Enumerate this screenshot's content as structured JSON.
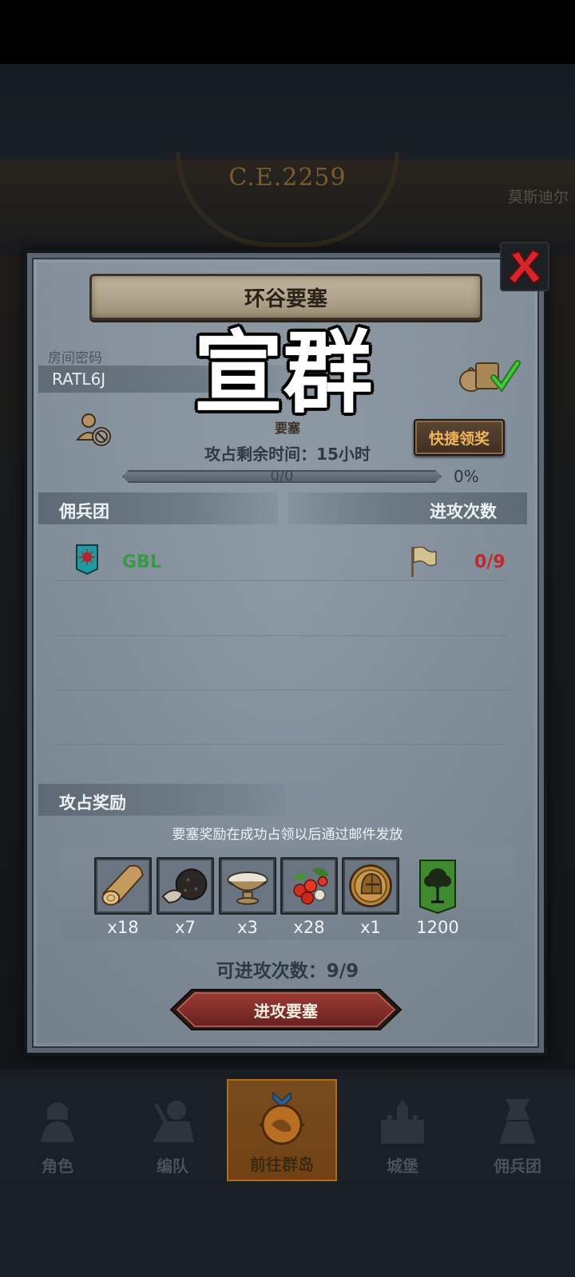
{
  "background": {
    "year": "C.E.2259",
    "place": "莫斯迪尔"
  },
  "dialog": {
    "title": "环谷要塞",
    "room_label": "房间密码",
    "room_code": "RATL6J",
    "watermark": "宣群",
    "fortress_sub": "要塞",
    "quick_claim": "快捷领奖",
    "time_remaining": "攻占剩余时间：15小时",
    "progress_text": "0/0",
    "progress_percent": "0%",
    "progress_value": 0,
    "mercenary_header": "佣兵团",
    "attack_count_header": "进攻次数",
    "guild": {
      "name": "GBL",
      "attacks": "0/9"
    },
    "rewards_header": "攻占奖励",
    "reward_note": "要塞奖励在成功占领以后通过邮件发放",
    "rewards": [
      {
        "icon": "wood-log-icon",
        "qty": "x18"
      },
      {
        "icon": "truffle-icon",
        "qty": "x7"
      },
      {
        "icon": "bowl-icon",
        "qty": "x3"
      },
      {
        "icon": "berries-icon",
        "qty": "x28"
      },
      {
        "icon": "knight-helmet-coin-icon",
        "qty": "x1"
      },
      {
        "icon": "tree-banner-icon",
        "qty": "1200"
      }
    ],
    "attack_times": "可进攻次数：9/9",
    "attack_button": "进攻要塞"
  },
  "nav": {
    "items": [
      {
        "label": "角色",
        "icon": "knight-icon"
      },
      {
        "label": "编队",
        "icon": "soldier-icon"
      },
      {
        "label": "前往群岛",
        "icon": "island-compass-icon",
        "active": true
      },
      {
        "label": "城堡",
        "icon": "castle-icon"
      },
      {
        "label": "佣兵团",
        "icon": "mercenary-icon"
      }
    ]
  },
  "colors": {
    "panel": "#8794a0",
    "accent_orange": "#f0b45a",
    "guild_green": "#3a9a44",
    "attack_red": "#c0292c",
    "button_red": "#8a2b2b"
  }
}
